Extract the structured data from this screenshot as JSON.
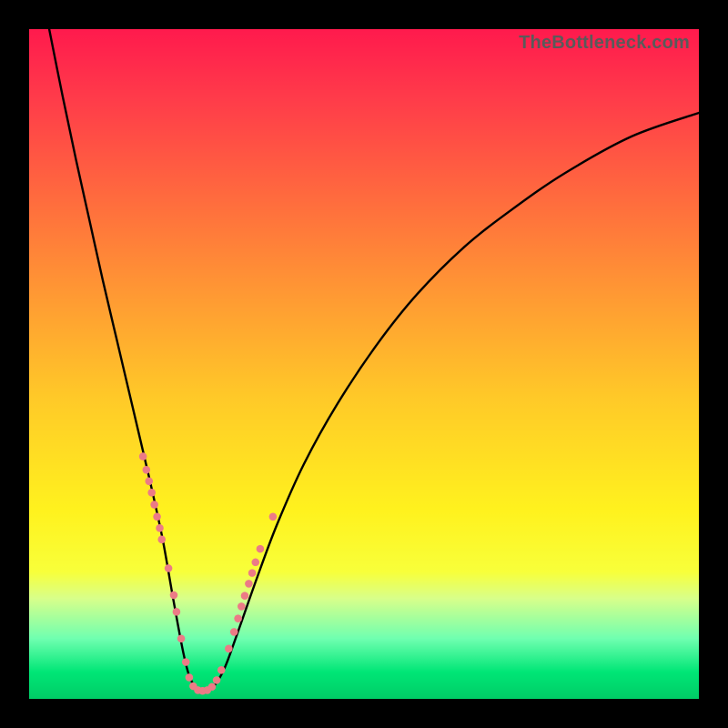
{
  "attribution": "TheBottleneck.com",
  "colors": {
    "frame": "#000000",
    "curve_stroke": "#000000",
    "dot_fill": "#ec7b86",
    "dot_stroke": "#ec7b86"
  },
  "chart_data": {
    "type": "line",
    "title": "",
    "xlabel": "",
    "ylabel": "",
    "xlim": [
      0,
      100
    ],
    "ylim": [
      0,
      100
    ],
    "series": [
      {
        "name": "bottleneck-curve",
        "x": [
          3.0,
          5.0,
          7.0,
          9.0,
          11.0,
          13.0,
          15.0,
          17.0,
          18.5,
          20.0,
          21.5,
          23.0,
          24.0,
          25.3,
          27.0,
          29.0,
          31.0,
          34.0,
          37.0,
          41.0,
          46.0,
          52.0,
          58.0,
          65.0,
          72.0,
          80.0,
          90.0,
          100.0
        ],
        "y": [
          100.0,
          90.0,
          80.5,
          71.5,
          62.5,
          54.0,
          45.5,
          37.0,
          30.5,
          23.5,
          15.0,
          7.0,
          3.2,
          1.3,
          1.3,
          4.2,
          9.5,
          18.0,
          26.0,
          35.0,
          44.0,
          53.0,
          60.5,
          67.5,
          73.0,
          78.5,
          84.0,
          87.5
        ]
      }
    ],
    "dots": [
      {
        "x_pct": 17.0,
        "y_pct": 36.2,
        "r": 4.3
      },
      {
        "x_pct": 17.5,
        "y_pct": 34.2,
        "r": 4.3
      },
      {
        "x_pct": 17.9,
        "y_pct": 32.5,
        "r": 4.3
      },
      {
        "x_pct": 18.3,
        "y_pct": 30.8,
        "r": 4.3
      },
      {
        "x_pct": 18.7,
        "y_pct": 29.0,
        "r": 4.3
      },
      {
        "x_pct": 19.1,
        "y_pct": 27.2,
        "r": 4.3
      },
      {
        "x_pct": 19.5,
        "y_pct": 25.5,
        "r": 4.3
      },
      {
        "x_pct": 19.8,
        "y_pct": 23.8,
        "r": 4.3
      },
      {
        "x_pct": 20.8,
        "y_pct": 19.5,
        "r": 4.3
      },
      {
        "x_pct": 21.6,
        "y_pct": 15.5,
        "r": 4.3
      },
      {
        "x_pct": 22.0,
        "y_pct": 13.0,
        "r": 4.3
      },
      {
        "x_pct": 22.7,
        "y_pct": 9.0,
        "r": 4.3
      },
      {
        "x_pct": 23.4,
        "y_pct": 5.5,
        "r": 4.3
      },
      {
        "x_pct": 23.9,
        "y_pct": 3.2,
        "r": 4.3
      },
      {
        "x_pct": 24.5,
        "y_pct": 1.9,
        "r": 4.3
      },
      {
        "x_pct": 25.2,
        "y_pct": 1.3,
        "r": 4.3
      },
      {
        "x_pct": 25.9,
        "y_pct": 1.2,
        "r": 4.3
      },
      {
        "x_pct": 26.6,
        "y_pct": 1.3,
        "r": 4.3
      },
      {
        "x_pct": 27.3,
        "y_pct": 1.8,
        "r": 4.3
      },
      {
        "x_pct": 28.0,
        "y_pct": 2.8,
        "r": 4.3
      },
      {
        "x_pct": 28.7,
        "y_pct": 4.3,
        "r": 4.3
      },
      {
        "x_pct": 29.8,
        "y_pct": 7.5,
        "r": 4.3
      },
      {
        "x_pct": 30.6,
        "y_pct": 10.0,
        "r": 4.3
      },
      {
        "x_pct": 31.2,
        "y_pct": 12.0,
        "r": 4.3
      },
      {
        "x_pct": 31.7,
        "y_pct": 13.8,
        "r": 4.3
      },
      {
        "x_pct": 32.2,
        "y_pct": 15.4,
        "r": 4.3
      },
      {
        "x_pct": 32.8,
        "y_pct": 17.2,
        "r": 4.3
      },
      {
        "x_pct": 33.3,
        "y_pct": 18.8,
        "r": 4.3
      },
      {
        "x_pct": 33.8,
        "y_pct": 20.4,
        "r": 4.3
      },
      {
        "x_pct": 34.5,
        "y_pct": 22.4,
        "r": 4.3
      },
      {
        "x_pct": 36.4,
        "y_pct": 27.2,
        "r": 4.3
      }
    ]
  }
}
